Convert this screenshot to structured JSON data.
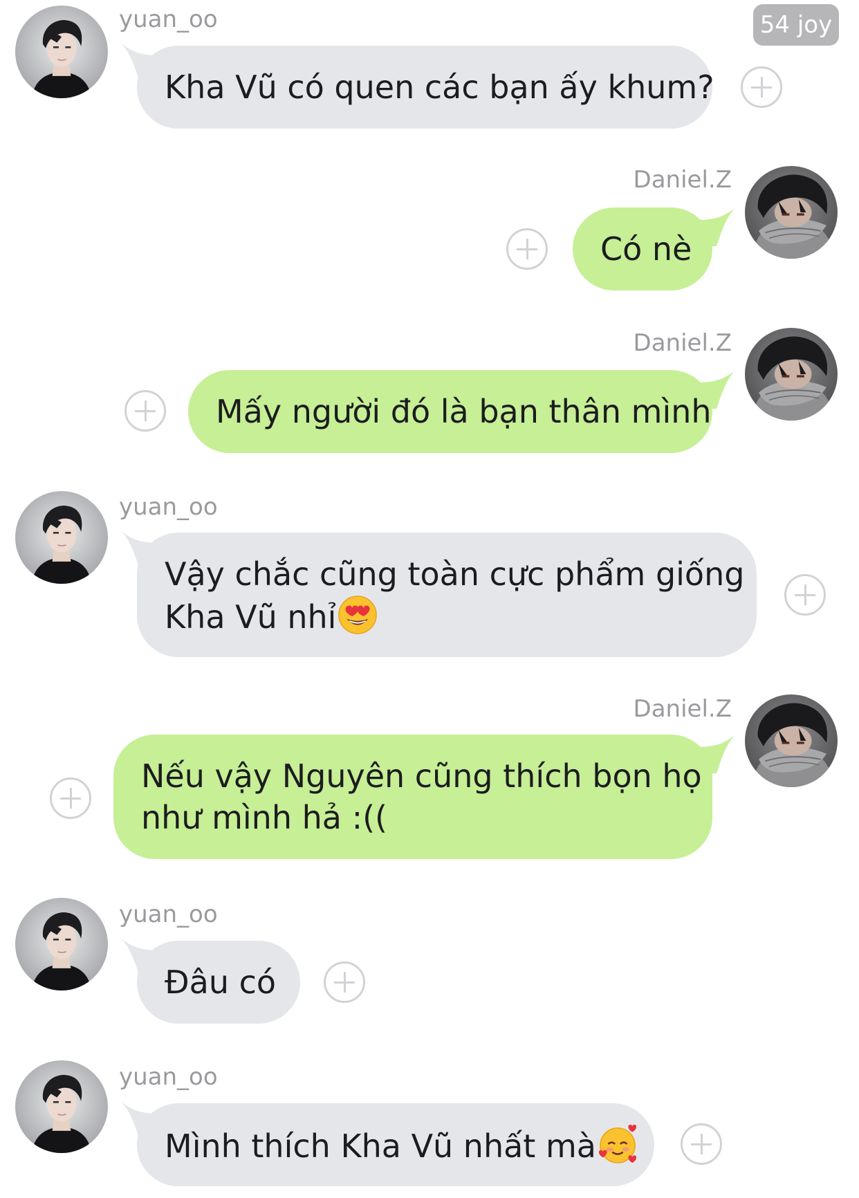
{
  "badge": {
    "label": "54 joy"
  },
  "colors": {
    "incoming_bubble": "#e5e6ea",
    "outgoing_bubble": "#c6ef96",
    "username": "#9a9a9e",
    "plus_icon": "#d2d2d6",
    "badge_bg": "#b6b6b9"
  },
  "messages": [
    {
      "sender": "yuan_oo",
      "side": "left",
      "lines": [
        "Kha Vũ có quen các bạn ấy khum?"
      ],
      "emoji": ""
    },
    {
      "sender": "Daniel.Z",
      "side": "right",
      "lines": [
        "Có nè"
      ],
      "emoji": ""
    },
    {
      "sender": "Daniel.Z",
      "side": "right",
      "lines": [
        "Mấy người đó là bạn thân mình"
      ],
      "emoji": ""
    },
    {
      "sender": "yuan_oo",
      "side": "left",
      "lines": [
        "Vậy chắc cũng toàn cực phẩm giống",
        "Kha Vũ nhỉ"
      ],
      "emoji": "heart-eyes-emoji"
    },
    {
      "sender": "Daniel.Z",
      "side": "right",
      "lines": [
        "Nếu vậy Nguyên cũng thích bọn họ",
        "như mình hả :(("
      ],
      "emoji": ""
    },
    {
      "sender": "yuan_oo",
      "side": "left",
      "lines": [
        "Đâu có"
      ],
      "emoji": ""
    },
    {
      "sender": "yuan_oo",
      "side": "left",
      "lines": [
        "Mình thích Kha Vũ nhất mà"
      ],
      "emoji": "smiling-with-hearts-emoji"
    }
  ],
  "icons": {
    "add_reaction": "plus-circle-icon",
    "avatar_yuan": "avatar-yuan-oo",
    "avatar_daniel": "avatar-daniel-z"
  }
}
